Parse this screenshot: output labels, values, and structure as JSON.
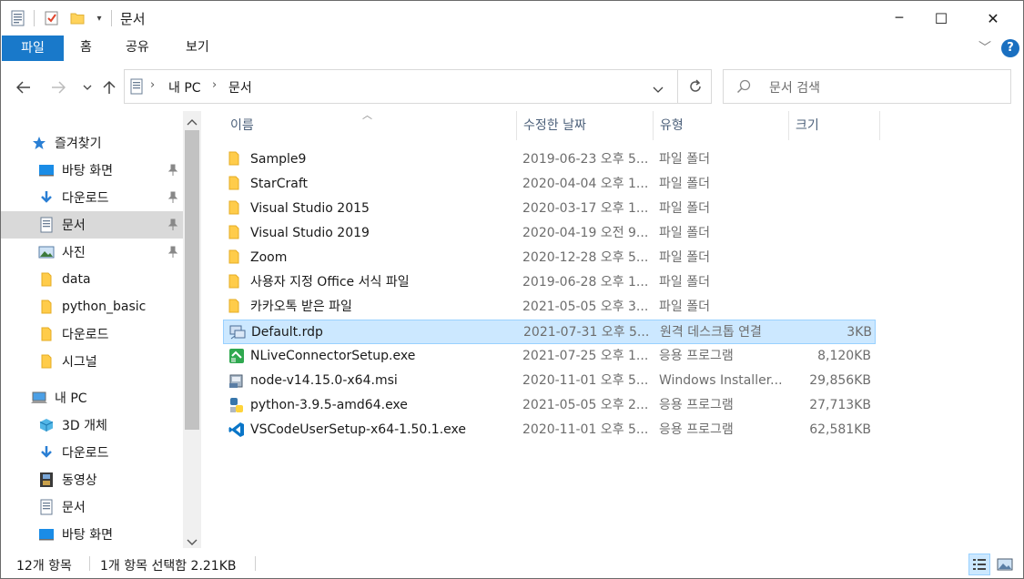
{
  "window": {
    "title": "문서",
    "controls": {
      "minimize": "─",
      "maximize": "☐",
      "close": "✕"
    }
  },
  "ribbon": {
    "tabs": [
      {
        "label": "파일"
      },
      {
        "label": "홈"
      },
      {
        "label": "공유"
      },
      {
        "label": "보기"
      }
    ],
    "help": "?"
  },
  "address": {
    "crumbs": [
      "내 PC",
      "문서"
    ],
    "search_placeholder": "문서 검색"
  },
  "nav": {
    "items": [
      {
        "label": "즐겨찾기",
        "icon": "star-icon"
      },
      {
        "label": "바탕 화면",
        "icon": "desktop-icon",
        "pinned": true
      },
      {
        "label": "다운로드",
        "icon": "download-icon",
        "pinned": true
      },
      {
        "label": "문서",
        "icon": "document-icon",
        "pinned": true,
        "selected": true
      },
      {
        "label": "사진",
        "icon": "pictures-icon",
        "pinned": true
      },
      {
        "label": "data",
        "icon": "folder-icon"
      },
      {
        "label": "python_basic",
        "icon": "folder-icon"
      },
      {
        "label": "다운로드",
        "icon": "folder-icon"
      },
      {
        "label": "시그널",
        "icon": "folder-icon"
      },
      {
        "label": "내 PC",
        "icon": "computer-icon"
      },
      {
        "label": "3D 개체",
        "icon": "3d-objects-icon"
      },
      {
        "label": "다운로드",
        "icon": "download-icon"
      },
      {
        "label": "동영상",
        "icon": "videos-icon"
      },
      {
        "label": "문서",
        "icon": "document-icon"
      },
      {
        "label": "바탕 화면",
        "icon": "desktop-icon"
      }
    ]
  },
  "columns": {
    "name": "이름",
    "date": "수정한 날짜",
    "type": "유형",
    "size": "크기"
  },
  "files": [
    {
      "name": "Sample9",
      "date": "2019-06-23 오후 5...",
      "type": "파일 폴더",
      "size": "",
      "icon": "folder-icon"
    },
    {
      "name": "StarCraft",
      "date": "2020-04-04 오후 1...",
      "type": "파일 폴더",
      "size": "",
      "icon": "folder-icon"
    },
    {
      "name": "Visual Studio 2015",
      "date": "2020-03-17 오후 1...",
      "type": "파일 폴더",
      "size": "",
      "icon": "folder-icon"
    },
    {
      "name": "Visual Studio 2019",
      "date": "2020-04-19 오전 9...",
      "type": "파일 폴더",
      "size": "",
      "icon": "folder-icon"
    },
    {
      "name": "Zoom",
      "date": "2020-12-28 오후 5...",
      "type": "파일 폴더",
      "size": "",
      "icon": "folder-icon"
    },
    {
      "name": "사용자 지정 Office 서식 파일",
      "date": "2019-06-28 오후 1...",
      "type": "파일 폴더",
      "size": "",
      "icon": "folder-icon"
    },
    {
      "name": "카카오톡 받은 파일",
      "date": "2021-05-05 오후 3...",
      "type": "파일 폴더",
      "size": "",
      "icon": "folder-icon"
    },
    {
      "name": "Default.rdp",
      "date": "2021-07-31 오후 5...",
      "type": "원격 데스크톱 연결",
      "size": "3KB",
      "icon": "rdp-icon",
      "selected": true
    },
    {
      "name": "NLiveConnectorSetup.exe",
      "date": "2021-07-25 오후 1...",
      "type": "응용 프로그램",
      "size": "8,120KB",
      "icon": "installer-icon"
    },
    {
      "name": "node-v14.15.0-x64.msi",
      "date": "2020-11-01 오후 5...",
      "type": "Windows Installer...",
      "size": "29,856KB",
      "icon": "msi-icon"
    },
    {
      "name": "python-3.9.5-amd64.exe",
      "date": "2021-05-05 오후 2...",
      "type": "응용 프로그램",
      "size": "27,713KB",
      "icon": "python-icon"
    },
    {
      "name": "VSCodeUserSetup-x64-1.50.1.exe",
      "date": "2020-11-01 오후 5...",
      "type": "응용 프로그램",
      "size": "62,581KB",
      "icon": "vscode-icon"
    }
  ],
  "status": {
    "count": "12개 항목",
    "selection": "1개 항목 선택함 2.21KB"
  }
}
